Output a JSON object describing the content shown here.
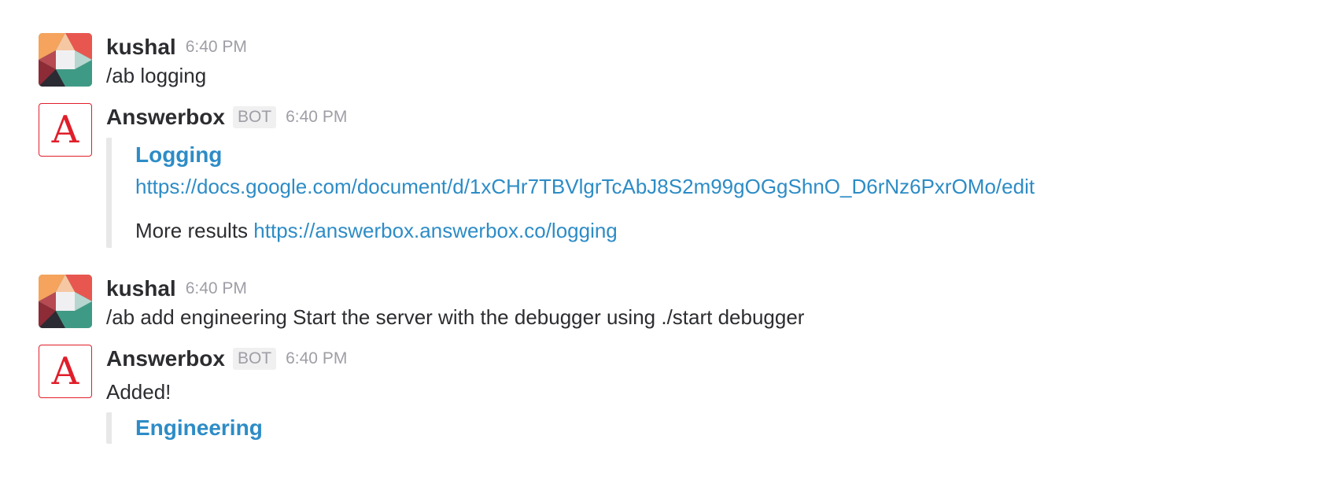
{
  "colors": {
    "link": "#2d8cc6",
    "bot_brand": "#e01e2a",
    "muted": "#9e9ea6",
    "attachment_bar": "#e8e8e8"
  },
  "messages": [
    {
      "sender": "kushal",
      "time": "6:40 PM",
      "text": "/ab logging",
      "avatar_icon": "user-avatar-icon"
    },
    {
      "sender": "Answerbox",
      "badge": "BOT",
      "time": "6:40 PM",
      "avatar_icon": "answerbox-logo-icon",
      "avatar_letter": "A",
      "attachment": {
        "title": "Logging",
        "url": "https://docs.google.com/document/d/1xCHr7TBVlgrTcAbJ8S2m99gOGgShnO_D6rNz6PxrOMo/edit",
        "more_label": "More results",
        "more_url": "https://answerbox.answerbox.co/logging"
      }
    },
    {
      "sender": "kushal",
      "time": "6:40 PM",
      "text": "/ab add engineering Start the server with the debugger using ./start debugger",
      "avatar_icon": "user-avatar-icon"
    },
    {
      "sender": "Answerbox",
      "badge": "BOT",
      "time": "6:40 PM",
      "avatar_icon": "answerbox-logo-icon",
      "avatar_letter": "A",
      "text": "Added!",
      "attachment": {
        "title": "Engineering"
      }
    }
  ]
}
